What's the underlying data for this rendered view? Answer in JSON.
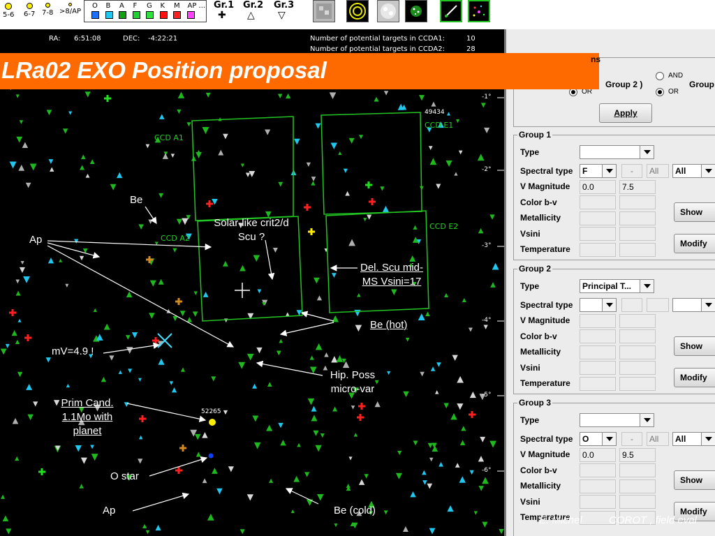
{
  "toolbar": {
    "mag_legend": [
      "5-6",
      "6-7",
      "7-8",
      ">8/AP"
    ],
    "spectral_letters": [
      "O",
      "B",
      "A",
      "F",
      "G",
      "K",
      "M",
      "AP ..."
    ],
    "spectral_colors": [
      "#1f6fff",
      "#20c8f0",
      "#10a010",
      "#20d030",
      "#30e040",
      "#ff1010",
      "#ff2020",
      "#ff40ff"
    ],
    "groups": [
      {
        "label": "Gr.1",
        "symbol": "✚"
      },
      {
        "label": "Gr.2",
        "symbol": "△"
      },
      {
        "label": "Gr.3",
        "symbol": "▽"
      }
    ]
  },
  "map": {
    "ra_label": "RA:",
    "ra_value": "6:51:08",
    "dec_label": "DEC:",
    "dec_value": "-4:22:21",
    "targets_ccda1_label": "Number of potential targets in CCDA1:",
    "targets_ccda1_value": "10",
    "targets_ccda2_label": "Number of potential targets in CCDA2:",
    "targets_ccda2_value": "28",
    "title": "LRa02 EXO Position proposal",
    "ccd_labels": {
      "a1": "CCD A1",
      "a2": "CCD A2",
      "e1": "CCD E1",
      "e2": "CCD E2"
    },
    "star_ids": {
      "s1": "49434",
      "s2": "52265"
    },
    "y_ticks": [
      "-1°",
      "-2°",
      "-3°",
      "-4°",
      "-5°",
      "-6°"
    ],
    "annotations": {
      "be": "Be",
      "ap_upper": "Ap",
      "solar_like": "Solar-like crit2/d Scu ?",
      "del_scu": "Del. Scu mid-MS Vsini=17",
      "be_hot": "Be (hot)",
      "mv": "mV=4.9 !",
      "hip_poss": "Hip. Poss micro-var",
      "prim_cand": "Prim Cand. 1.1Mo with planet",
      "o_star": "O star",
      "ap_lower": "Ap",
      "be_cold": "Be (cold)"
    }
  },
  "panel": {
    "top_frag": "ns",
    "group2_close": "Group 2 )",
    "group_right_frag": "Group",
    "radio_and": "AND",
    "radio_or_left": "OR",
    "radio_or_right": "OR",
    "apply": "Apply",
    "row_labels": [
      "Type",
      "Spectral type",
      "V Magnitude",
      "Color b-v",
      "Metallicity",
      "Vsini",
      "Temperature"
    ],
    "show": "Show",
    "modify": "Modify",
    "dash": "-",
    "all": "All",
    "group1": {
      "title": "Group 1",
      "type": "",
      "spectral": "F",
      "spectral_all": "All",
      "spectral_all2": "All",
      "vmag_min": "0.0",
      "vmag_max": "7.5"
    },
    "group2": {
      "title": "Group 2",
      "type": "Principal T...",
      "spectral": "",
      "vmag_min": "",
      "vmag_max": ""
    },
    "group3": {
      "title": "Group 3",
      "type": "",
      "spectral": "O",
      "spectral_all": "All",
      "spectral_all2": "All",
      "vmag_min": "0.0",
      "vmag_max": "9.5"
    },
    "footer_author": "E. Michel",
    "footer_title": "COROT , field eval"
  }
}
